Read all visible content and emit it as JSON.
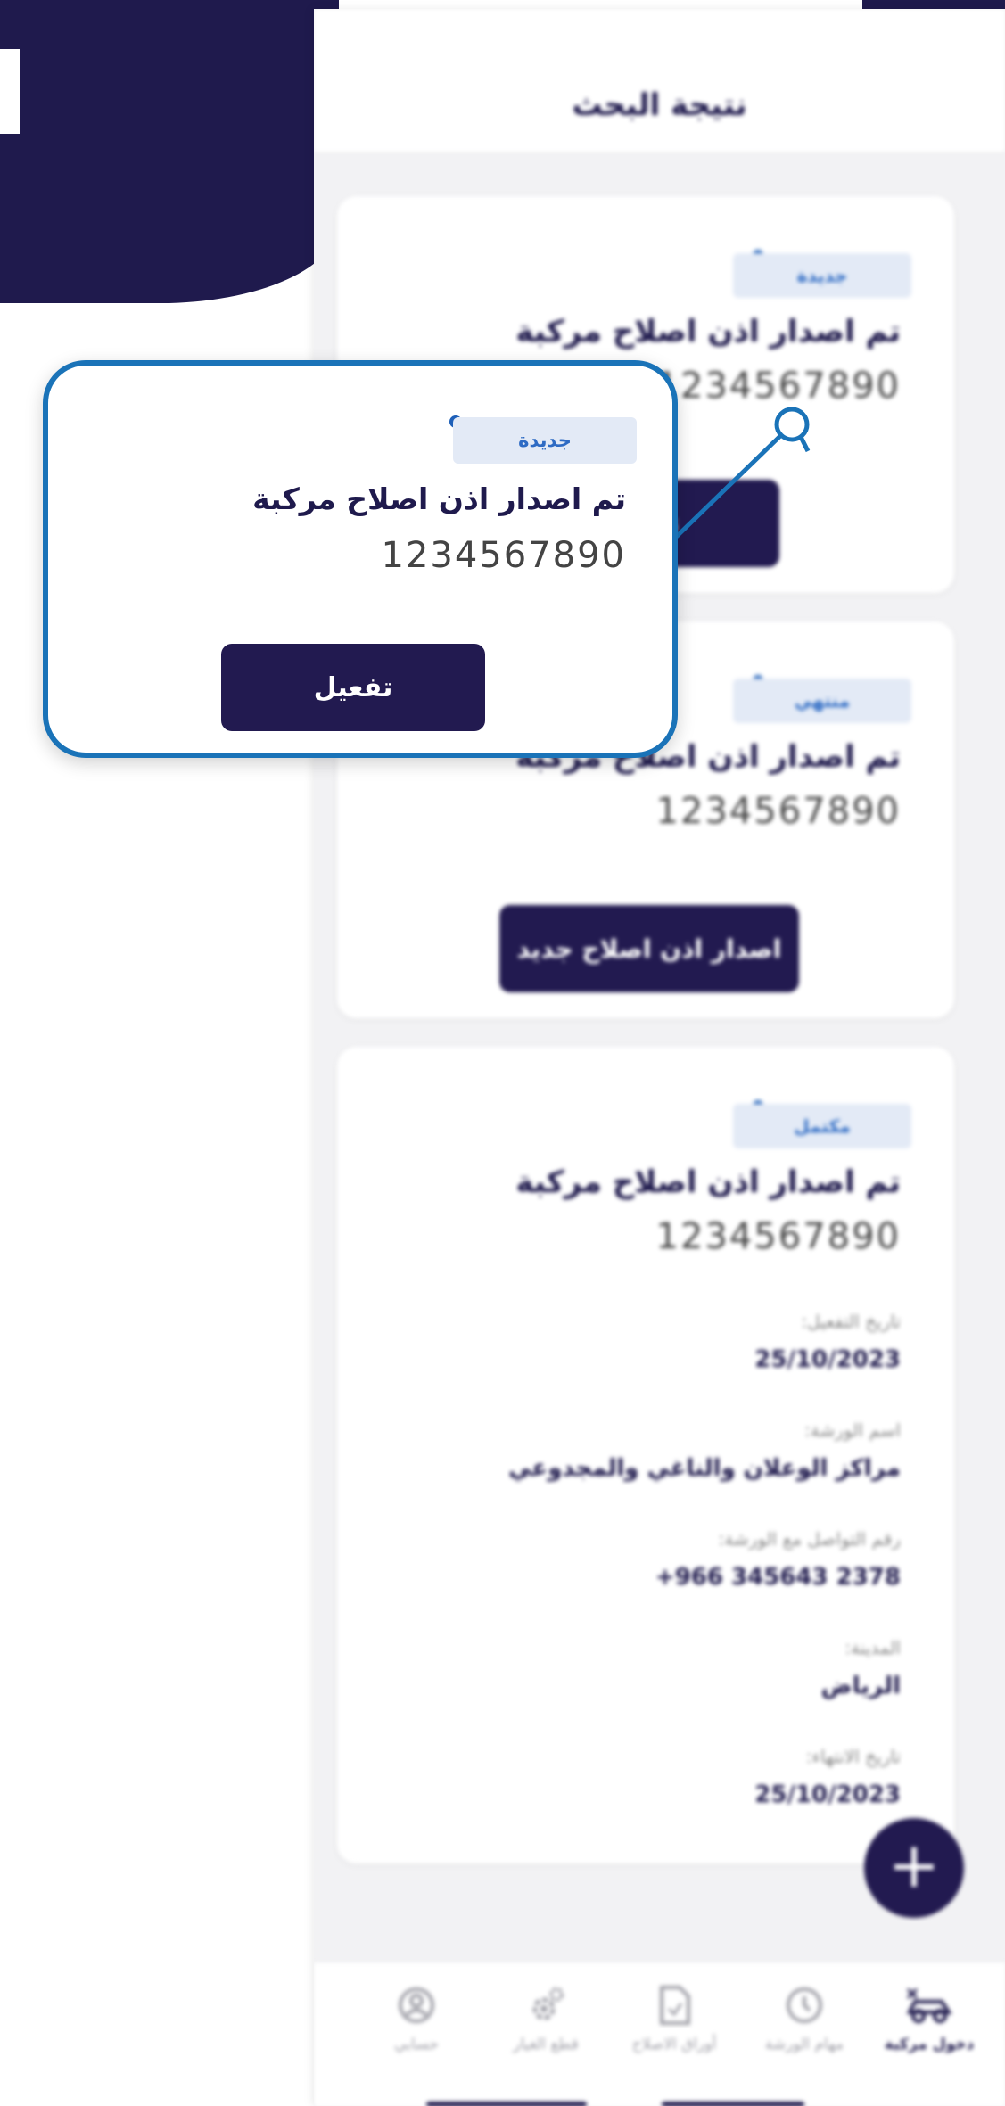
{
  "header": {
    "title": "نتيجة البحث"
  },
  "cards": [
    {
      "status": "جديدة",
      "title": "تم اصدار اذن اصلاح مركبة",
      "number": "1234567890",
      "button": "تفعيل"
    },
    {
      "status": "منتهي",
      "title": "تم اصدار اذن اصلاح مركبة",
      "number": "1234567890",
      "button": "اصدار اذن اصلاح جديد"
    },
    {
      "status": "مكتمل",
      "title": "تم اصدار اذن اصلاح مركبة",
      "number": "1234567890",
      "details": [
        {
          "label": "تاريخ التفعيل:",
          "value": "25/10/2023"
        },
        {
          "label": "اسم الورشة:",
          "value": "مراكز الوعلان والناغي والمجدوعي"
        },
        {
          "label": "رقم التواصل مع الورشة:",
          "value": "+966 345643 2378"
        },
        {
          "label": "المدينة:",
          "value": "الرياض"
        },
        {
          "label": "تاريخ الانتهاء:",
          "value": "25/10/2023"
        }
      ]
    }
  ],
  "callout": {
    "status": "جديدة",
    "title": "تم اصدار اذن اصلاح مركبة",
    "number": "1234567890",
    "button": "تفعيل"
  },
  "fab": {
    "symbol": "+"
  },
  "nav": {
    "items": [
      {
        "label": "دخول مركبة",
        "icon": "car-wrench-icon"
      },
      {
        "label": "مهام الورشة",
        "icon": "clock-icon"
      },
      {
        "label": "أوراق الاصلاح",
        "icon": "document-icon"
      },
      {
        "label": "قطع الغيار",
        "icon": "gear-icon"
      },
      {
        "label": "حسابي",
        "icon": "user-icon"
      }
    ]
  },
  "colors": {
    "primary": "#221a50",
    "accent": "#1a73b8",
    "badge_bg": "#e3eaf6"
  }
}
